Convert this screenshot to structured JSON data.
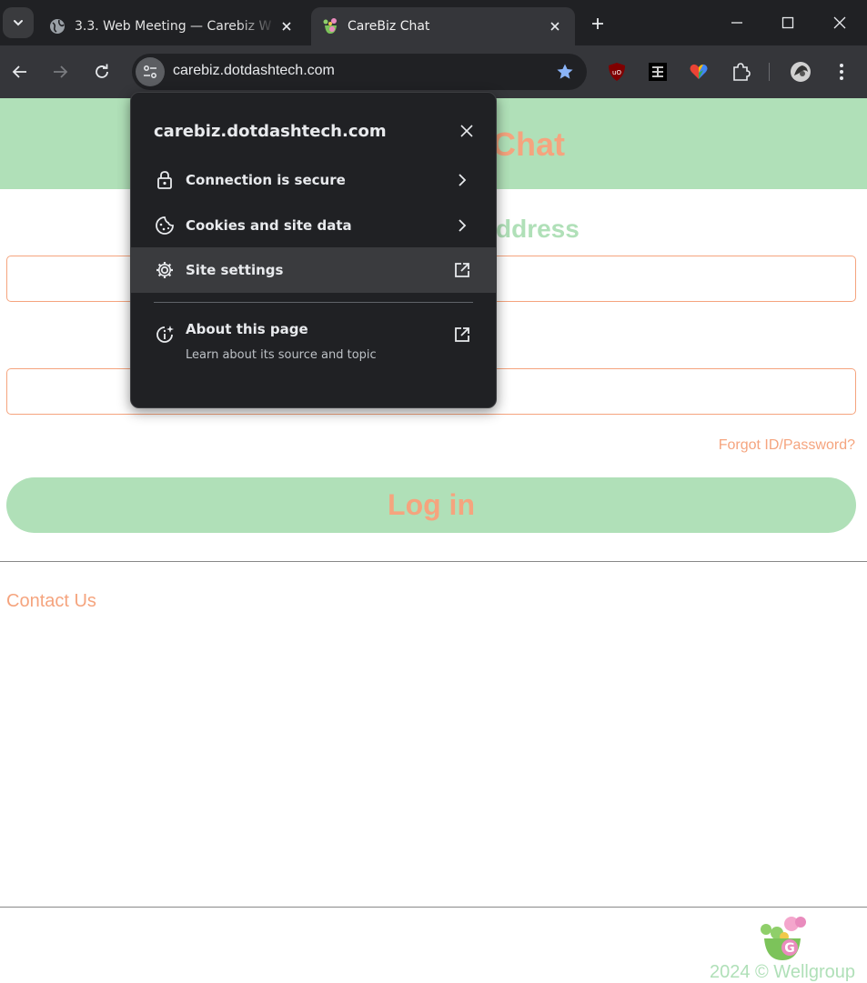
{
  "browser": {
    "tabs": [
      {
        "title": "3.3. Web Meeting — Carebiz W",
        "favicon": "globe-icon",
        "active": false
      },
      {
        "title": "CareBiz Chat",
        "favicon": "carebiz-logo-icon",
        "active": true
      }
    ],
    "url": "carebiz.dotdashtech.com",
    "extensions": [
      "ublock-icon",
      "reader-icon",
      "heart-extension-icon",
      "puzzle-icon"
    ]
  },
  "site_info": {
    "domain": "carebiz.dotdashtech.com",
    "items": [
      {
        "label": "Connection is secure",
        "icon": "lock-icon",
        "action": "chevron-right-icon"
      },
      {
        "label": "Cookies and site data",
        "icon": "cookie-icon",
        "action": "chevron-right-icon"
      },
      {
        "label": "Site settings",
        "icon": "gear-icon",
        "action": "open-external-icon",
        "highlighted": true
      }
    ],
    "about": {
      "label": "About this page",
      "sub": "Learn about its source and topic",
      "icon": "info-sparkle-icon"
    }
  },
  "page": {
    "title": "Chat",
    "id_label": "ddress",
    "id_value": "",
    "password_value": "",
    "forgot_link": "Forgot ID/Password?",
    "login_button": "Log in",
    "contact": "Contact Us",
    "copyright": "2024 © Wellgroup"
  },
  "colors": {
    "accent_green": "#b0e0b8",
    "accent_orange": "#f5a47e",
    "chrome_dark": "#202124",
    "chrome_toolbar": "#35363a"
  }
}
